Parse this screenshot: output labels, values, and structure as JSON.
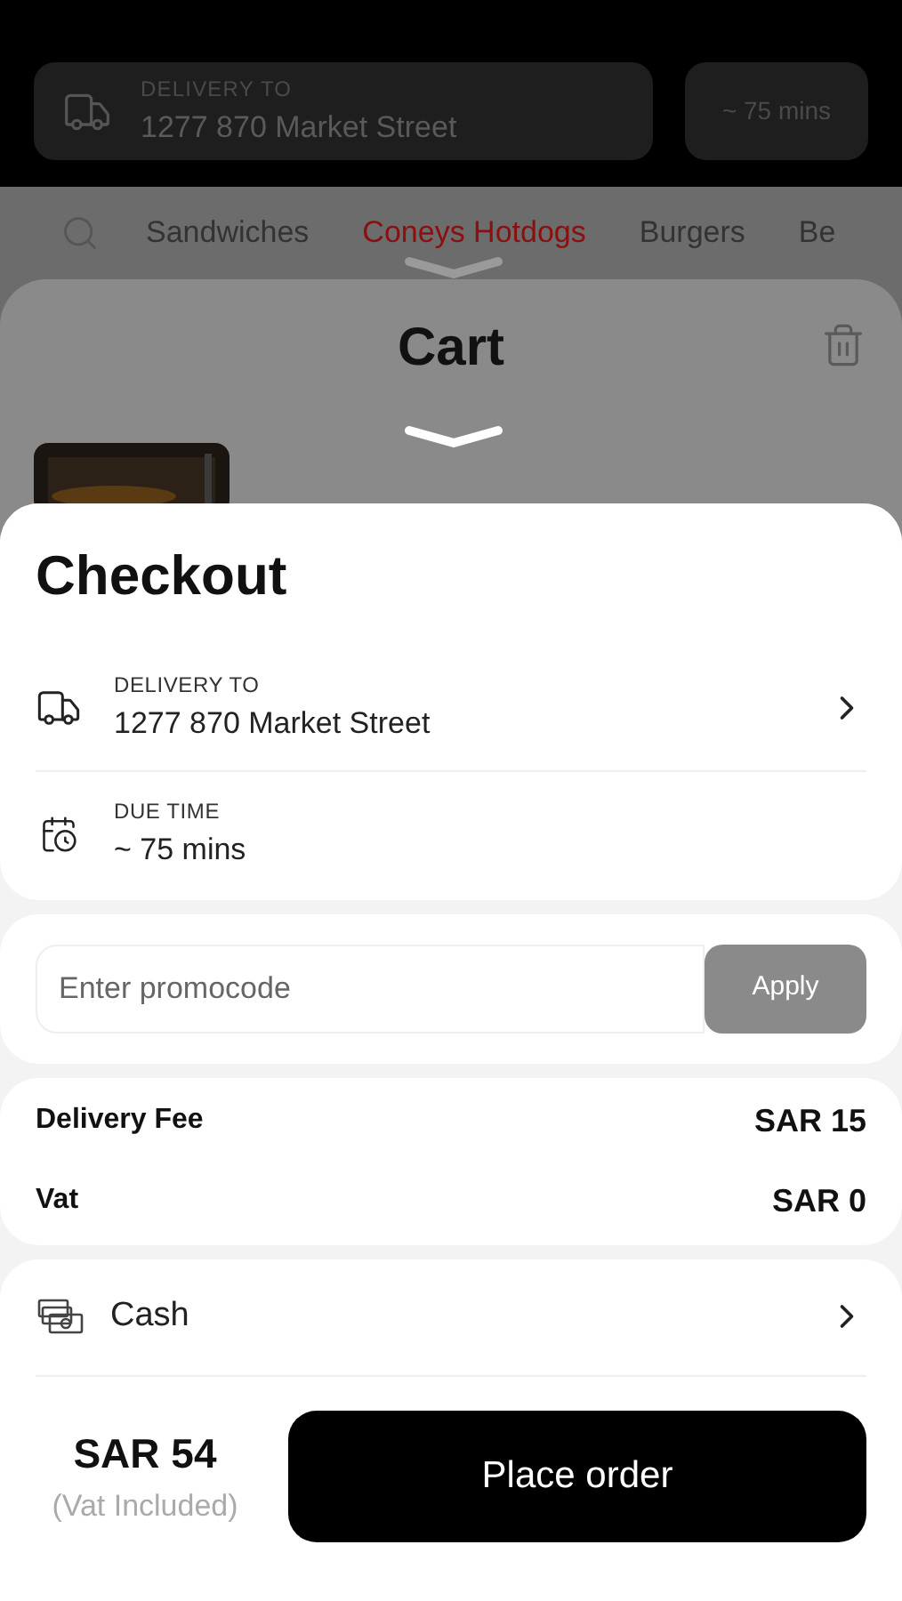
{
  "header": {
    "delivery_label": "DELIVERY TO",
    "address": "1277 870 Market Street",
    "eta": "~ 75 mins"
  },
  "categories": [
    {
      "label": "Sandwiches",
      "selected": false
    },
    {
      "label": "Coneys Hotdogs",
      "selected": true
    },
    {
      "label": "Burgers",
      "selected": false
    },
    {
      "label": "Be",
      "selected": false
    }
  ],
  "cart": {
    "title": "Cart"
  },
  "checkout": {
    "title": "Checkout",
    "rows": [
      {
        "kind": "delivery",
        "label": "DELIVERY TO",
        "value": "1277 870 Market Street"
      },
      {
        "kind": "time",
        "label": "DUE TIME",
        "value": "~ 75 mins"
      }
    ]
  },
  "promo": {
    "placeholder": "Enter promocode",
    "button": "Apply"
  },
  "fees": [
    {
      "label": "Delivery Fee",
      "value": "SAR 15"
    },
    {
      "label": "Vat",
      "value": "SAR 0"
    }
  ],
  "payment": {
    "method": "Cash"
  },
  "total": {
    "amount": "SAR 54",
    "note": "(Vat Included)"
  },
  "place_order": "Place order"
}
